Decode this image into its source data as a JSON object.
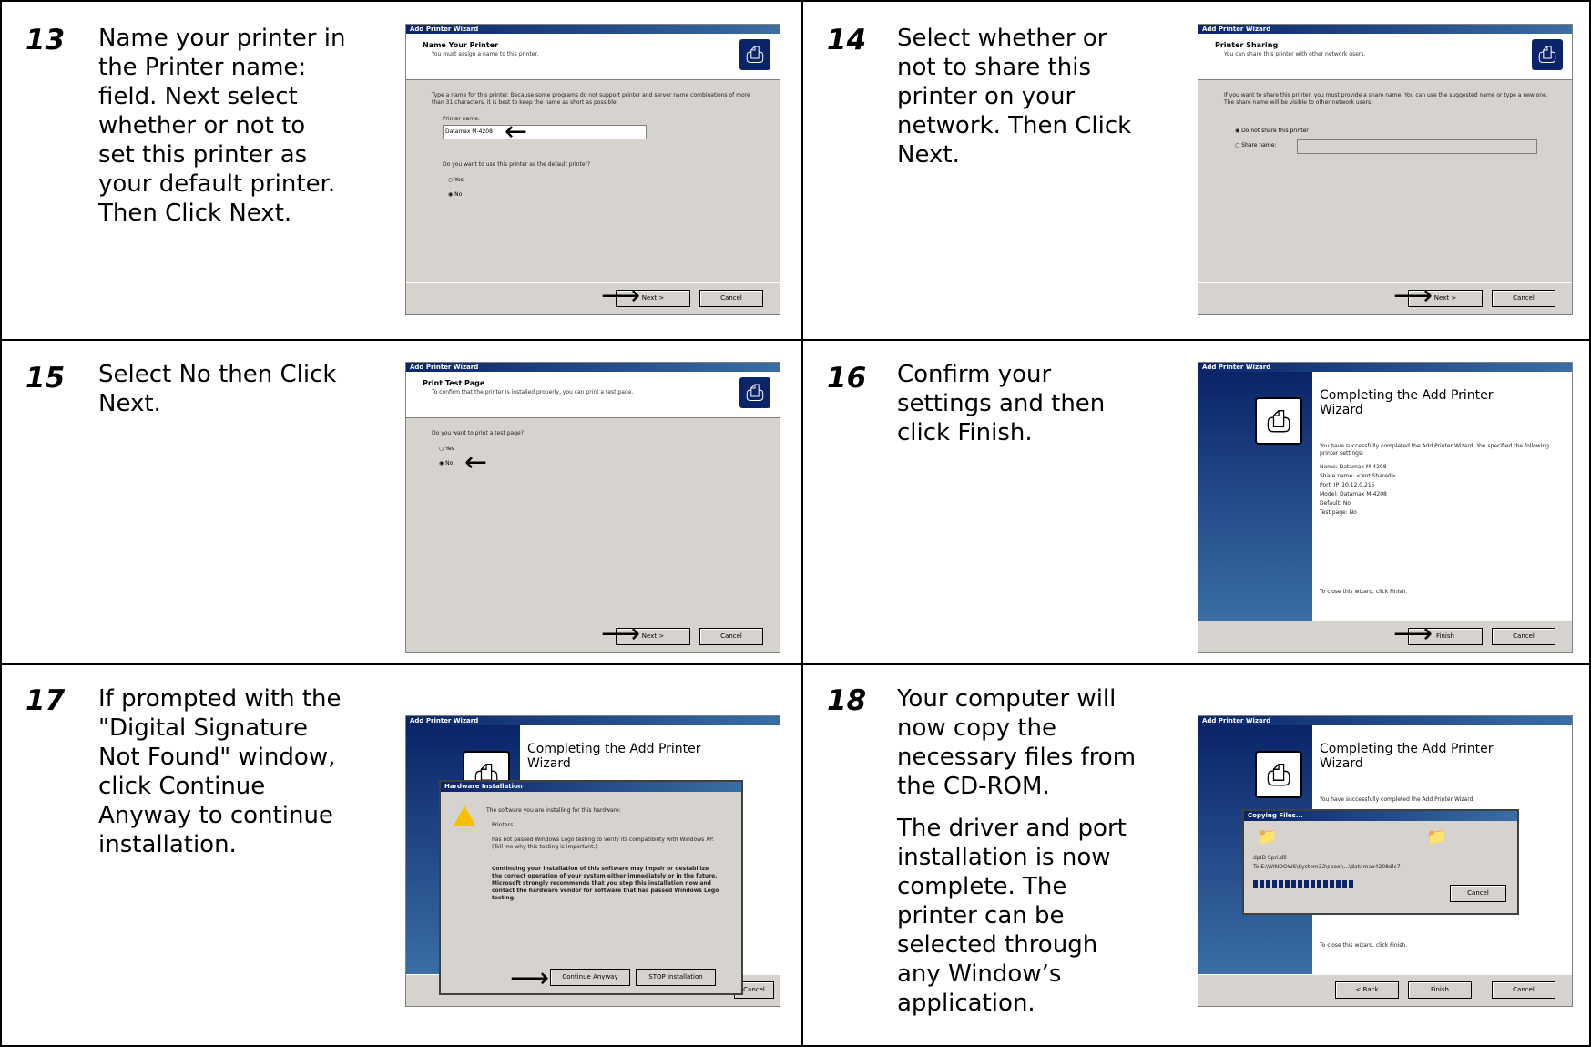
{
  "steps": [
    {
      "num": "13",
      "paragraphs": [
        "Name your printer in the Printer name: field.  Next select whether or not to set this printer as your default printer. Then Click Next."
      ]
    },
    {
      "num": "14",
      "paragraphs": [
        "Select whether or not to share this printer on your network. Then Click Next."
      ]
    },
    {
      "num": "15",
      "paragraphs": [
        "Select No then Click Next."
      ]
    },
    {
      "num": "16",
      "paragraphs": [
        "Confirm your settings and then click Finish."
      ]
    },
    {
      "num": "17",
      "paragraphs": [
        "If prompted with the \"Digital Signature Not Found\" window, click Continue Anyway to continue installation."
      ]
    },
    {
      "num": "18",
      "paragraphs": [
        "Your computer will now copy the necessary files from the CD-ROM.",
        "The driver and port installation is now complete. The printer can be selected through any Window’s application."
      ]
    }
  ],
  "screens": {
    "wizard_title": "Add Printer Wizard",
    "s13": {
      "header": "Name Your Printer",
      "sub": "You must assign a name to this printer.",
      "body": "Type a name for this printer. Because some programs do not support printer and server name combinations of more than 31 characters, it is best to keep the name as short as possible.",
      "field_label": "Printer name:",
      "field_value": "Datamax M-4208",
      "question": "Do you want to use this printer as the default printer?",
      "opt1": "Yes",
      "opt2": "No",
      "next": "Next >",
      "cancel": "Cancel"
    },
    "s14": {
      "header": "Printer Sharing",
      "sub": "You can share this printer with other network users.",
      "body": "If you want to share this printer, you must provide a share name. You can use the suggested name or type a new one. The share name will be visible to other network users.",
      "opt1": "Do not share this printer",
      "opt2": "Share name:",
      "next": "Next >",
      "cancel": "Cancel"
    },
    "s15": {
      "header": "Print Test Page",
      "sub": "To confirm that the printer is installed properly, you can print a test page.",
      "question": "Do you want to print a test page?",
      "opt1": "Yes",
      "opt2": "No",
      "next": "Next >",
      "cancel": "Cancel"
    },
    "s16": {
      "title": "Completing the Add Printer Wizard",
      "intro": "You have successfully completed the Add Printer Wizard. You specified the following printer settings:",
      "settings": "Name:  Datamax M-4208\nShare name:  <Not Shared>\nPort:  IP_10.12.0.215\nModel:  Datamax M-4208\nDefault:  No\nTest page:  No",
      "close": "To close this wizard, click Finish.",
      "finish": "Finish",
      "cancel": "Cancel"
    },
    "s17": {
      "title": "Completing the Add Printer Wizard",
      "dlg_title": "Hardware Installation",
      "line1": "The software you are installing for this hardware:",
      "line2": "Printers",
      "line3": "has not passed Windows Logo testing to verify its compatibility with Windows XP. (Tell me why this testing is important.)",
      "warning": "Continuing your installation of this software may impair or destabilize the correct operation of your system either immediately or in the future. Microsoft strongly recommends that you stop this installation now and contact the hardware vendor for software that has passed Windows Logo testing.",
      "continue": "Continue Anyway",
      "stop": "STOP Installation",
      "cancel": "Cancel"
    },
    "s18": {
      "title": "Completing the Add Printer Wizard",
      "intro": "You have successfully completed the Add Printer Wizard.",
      "dlg_title": "Copying Files...",
      "file": "dpID Spri.dll",
      "dest": "To E:\\WINDOWS\\System32\\spool\\...\\datamax4208dlc7",
      "close": "To close this wizard, click Finish.",
      "back": "< Back",
      "finish": "Finish",
      "cancel": "Cancel",
      "progress": 0.55
    }
  }
}
